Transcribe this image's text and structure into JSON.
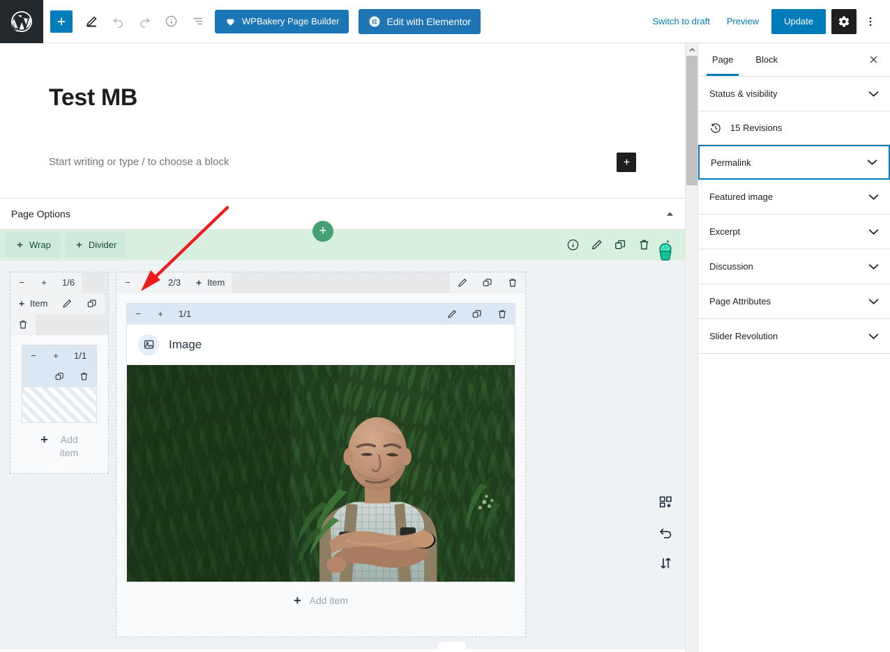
{
  "topbar": {
    "logo_icon": "wordpress-logo-icon",
    "add_block_label": "+",
    "tools": [
      {
        "name": "add-block-button",
        "icon": "plus-icon",
        "label": "Add block"
      },
      {
        "name": "tools-pencil-button",
        "icon": "pencil-icon",
        "label": "Tools"
      },
      {
        "name": "undo-button",
        "icon": "undo-icon",
        "label": "Undo"
      },
      {
        "name": "redo-button",
        "icon": "redo-icon",
        "label": "Redo"
      },
      {
        "name": "details-button",
        "icon": "info-icon",
        "label": "Details"
      },
      {
        "name": "list-view-button",
        "icon": "list-view-icon",
        "label": "List View"
      }
    ],
    "wpbakery_label": "WPBakery Page Builder",
    "elementor_label": "Edit with Elementor",
    "switch_to_draft_label": "Switch to draft",
    "preview_label": "Preview",
    "update_label": "Update",
    "settings_icon": "gear-icon",
    "more_icon": "kebab-menu-icon"
  },
  "editor": {
    "post_title": "Test MB",
    "paragraph_placeholder": "Start writing or type / to choose a block",
    "inserter_icon": "plus-icon"
  },
  "metabox": {
    "title": "Page Options",
    "collapse_icon": "triangle-up-icon"
  },
  "builder_bar": {
    "wrap_label": "Wrap",
    "divider_label": "Divider",
    "round_add_label": "+",
    "tools": [
      {
        "name": "builder-info-button",
        "icon": "info-icon"
      },
      {
        "name": "builder-edit-button",
        "icon": "pencil-icon"
      },
      {
        "name": "builder-duplicate-button",
        "icon": "duplicate-icon"
      },
      {
        "name": "builder-delete-button",
        "icon": "trash-icon"
      },
      {
        "name": "builder-more-button",
        "icon": "kebab-menu-icon"
      }
    ]
  },
  "left_column": {
    "minus_label": "−",
    "plus_label": "+",
    "width_label": "1/6",
    "item_label": "Item",
    "item_plus": "+",
    "edit_icon": "pencil-icon",
    "duplicate_icon": "duplicate-icon",
    "delete_icon": "trash-icon",
    "inner": {
      "minus_label": "−",
      "plus_label": "+",
      "width_label": "1/1",
      "duplicate_icon": "duplicate-icon",
      "delete_icon": "trash-icon"
    },
    "add_item_plus": "+",
    "add_item_line1": "Add",
    "add_item_line2": "item"
  },
  "main_column": {
    "minus_label": "−",
    "plus_label": "+",
    "width_label": "2/3",
    "item_plus": "+",
    "item_label": "Item",
    "edit_icon": "pencil-icon",
    "duplicate_icon": "duplicate-icon",
    "delete_icon": "trash-icon",
    "inner_block": {
      "minus_label": "−",
      "plus_label": "+",
      "width_label": "1/1",
      "edit_icon": "pencil-icon",
      "duplicate_icon": "duplicate-icon",
      "delete_icon": "trash-icon",
      "block_title": "Image",
      "block_icon": "image-icon",
      "image_alt": "Elderly farmer with crossed arms standing in front of tall green hemp plants"
    },
    "add_item_plus": "+",
    "add_item_label": "Add item"
  },
  "rail": {
    "cupcake_icon": "cupcake-icon",
    "bottom_icons": [
      {
        "name": "add-template-icon",
        "icon": "add-template-icon"
      },
      {
        "name": "revert-icon",
        "icon": "undo-arrow-icon"
      },
      {
        "name": "reorder-icon",
        "icon": "sort-updown-icon"
      }
    ]
  },
  "scrollbar": {
    "up_arrow_icon": "chevron-up-icon"
  },
  "sidebar": {
    "tabs": [
      {
        "label": "Page",
        "active": true
      },
      {
        "label": "Block",
        "active": false
      }
    ],
    "close_icon": "close-icon",
    "revisions_icon": "revisions-clock-icon",
    "revisions_label": "15 Revisions",
    "panels": [
      {
        "label": "Status & visibility",
        "focused": false
      },
      {
        "label": "Permalink",
        "focused": true
      },
      {
        "label": "Featured image",
        "focused": false
      },
      {
        "label": "Excerpt",
        "focused": false
      },
      {
        "label": "Discussion",
        "focused": false
      },
      {
        "label": "Page Attributes",
        "focused": false
      },
      {
        "label": "Slider Revolution",
        "focused": false
      }
    ]
  },
  "annotation": {
    "arrow_color": "#ee1c1c",
    "arrow_name": "red-pointer-arrow"
  },
  "colors": {
    "accent_blue": "#007cba",
    "builder_green": "#d9f0e0",
    "round_add_green": "#45a173",
    "panel_focus": "#007cba"
  }
}
